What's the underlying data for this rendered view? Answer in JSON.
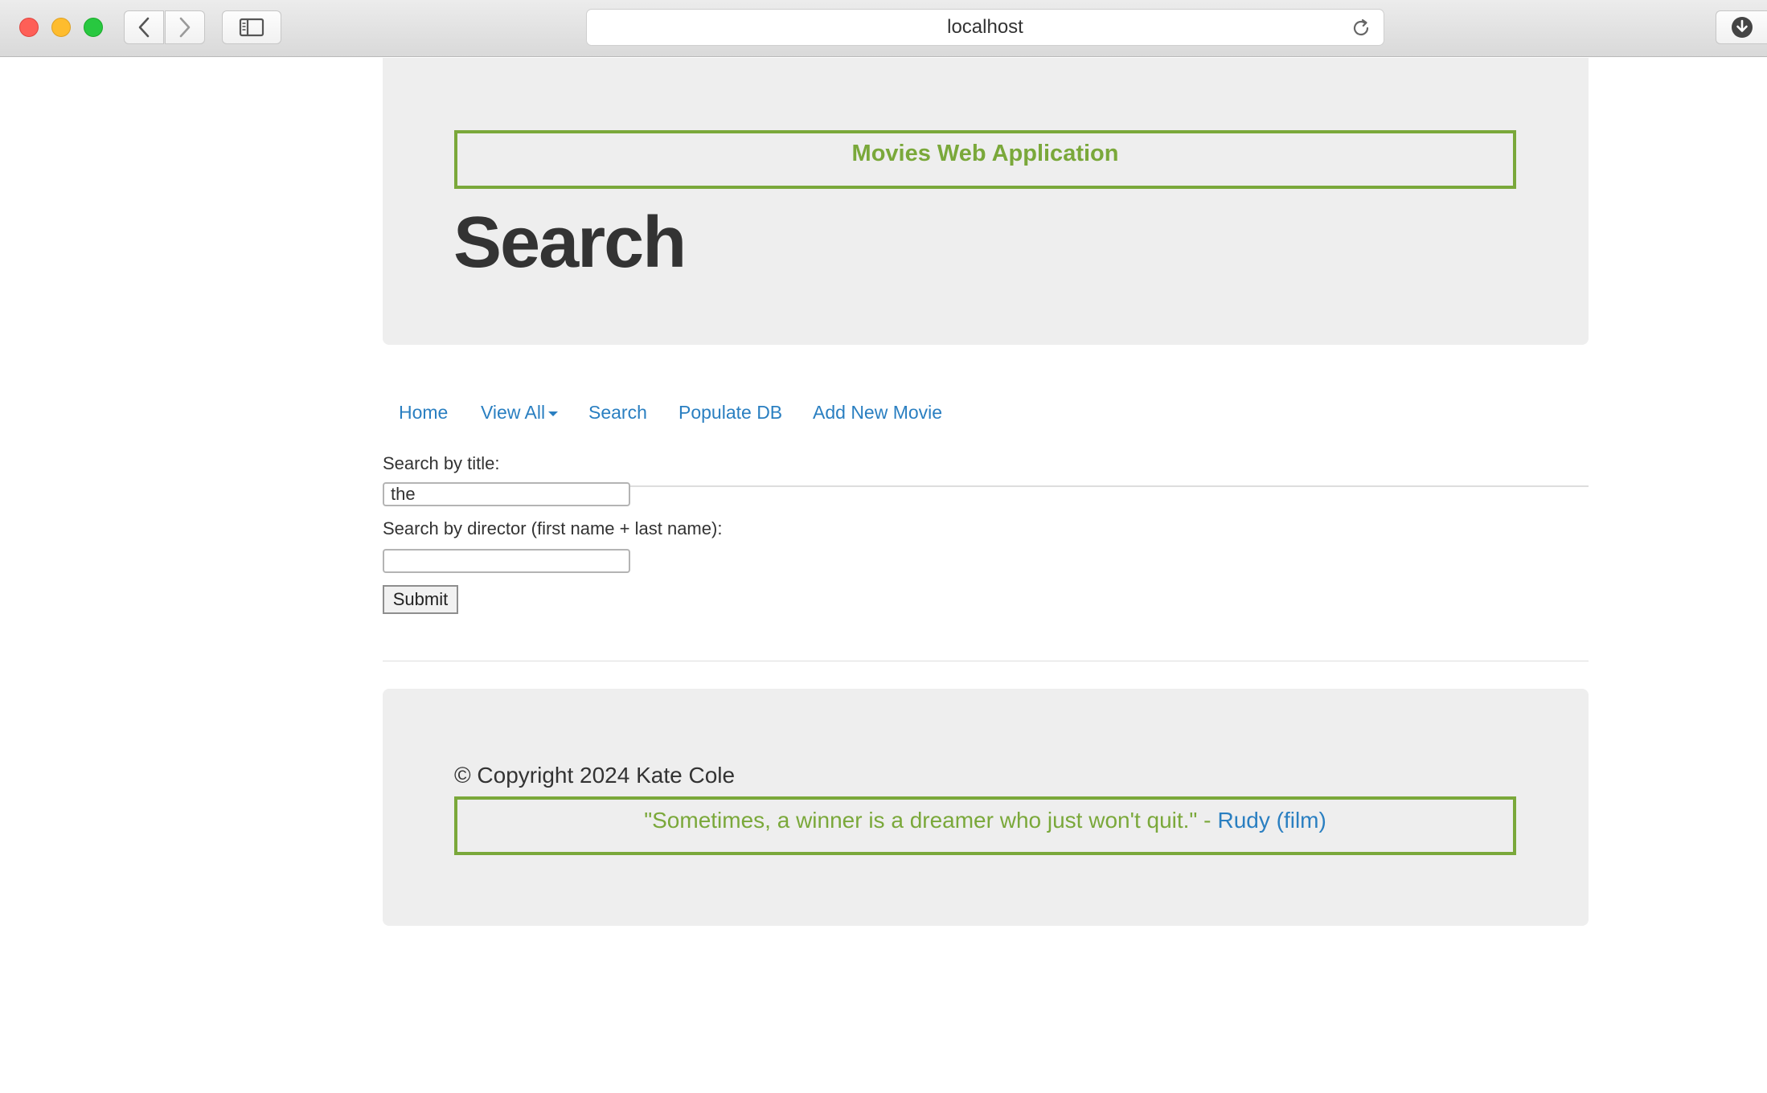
{
  "browser": {
    "url": "localhost"
  },
  "header": {
    "banner": "Movies Web Application",
    "title": "Search"
  },
  "nav": {
    "items": [
      {
        "label": "Home"
      },
      {
        "label": "View All"
      },
      {
        "label": "Search"
      },
      {
        "label": "Populate DB"
      },
      {
        "label": "Add New Movie"
      }
    ]
  },
  "form": {
    "title_label": "Search by title:",
    "title_value": "the",
    "director_label": "Search by director (first name + last name):",
    "director_value": "",
    "submit_label": "Submit"
  },
  "footer": {
    "copyright": "© Copyright 2024 Kate Cole",
    "quote": "\"Sometimes, a winner is a dreamer who just won't quit.\" -",
    "quote_source": "Rudy (film)"
  },
  "colors": {
    "accent_green": "#7aa83a",
    "link_blue": "#2a7fc1",
    "panel_gray": "#eeeeee"
  }
}
